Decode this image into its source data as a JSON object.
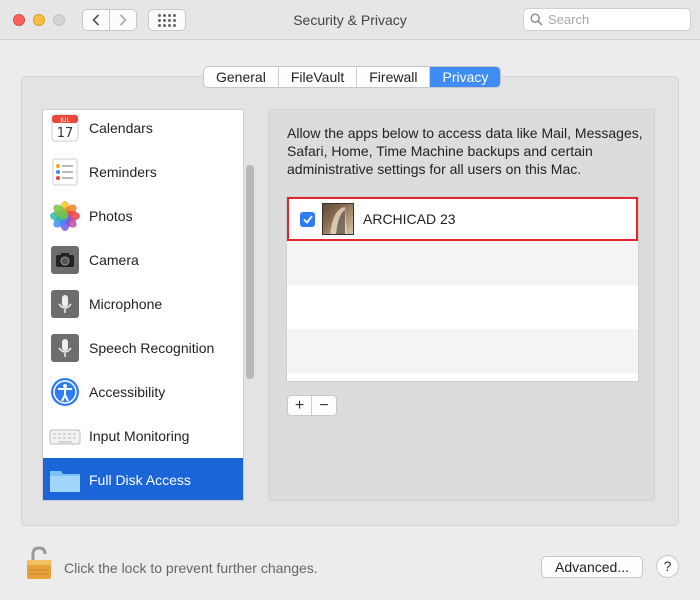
{
  "window": {
    "title": "Security & Privacy"
  },
  "search": {
    "placeholder": "Search"
  },
  "tabs": [
    {
      "label": "General",
      "active": false
    },
    {
      "label": "FileVault",
      "active": false
    },
    {
      "label": "Firewall",
      "active": false
    },
    {
      "label": "Privacy",
      "active": true
    }
  ],
  "sidebar": {
    "items": [
      {
        "label": "Calendars",
        "icon": "calendar-icon",
        "calendar_month": "JUL",
        "calendar_day": "17"
      },
      {
        "label": "Reminders",
        "icon": "reminders-icon"
      },
      {
        "label": "Photos",
        "icon": "photos-icon"
      },
      {
        "label": "Camera",
        "icon": "camera-icon"
      },
      {
        "label": "Microphone",
        "icon": "microphone-icon"
      },
      {
        "label": "Speech Recognition",
        "icon": "speech-recognition-icon"
      },
      {
        "label": "Accessibility",
        "icon": "accessibility-icon"
      },
      {
        "label": "Input Monitoring",
        "icon": "keyboard-icon"
      },
      {
        "label": "Full Disk Access",
        "icon": "folder-icon",
        "selected": true
      }
    ]
  },
  "main": {
    "description": "Allow the apps below to access data like Mail, Messages, Safari, Home, Time Machine backups and certain administrative settings for all users on this Mac.",
    "apps": [
      {
        "name": "ARCHICAD 23",
        "checked": true,
        "icon": "archicad-icon"
      }
    ],
    "add_label": "+",
    "remove_label": "−"
  },
  "footer": {
    "lock_text": "Click the lock to prevent further changes.",
    "advanced_label": "Advanced...",
    "help_label": "?"
  },
  "colors": {
    "accent": "#1a66d8",
    "tab_active": "#3f8cf4",
    "highlight_border": "#e1262f"
  }
}
